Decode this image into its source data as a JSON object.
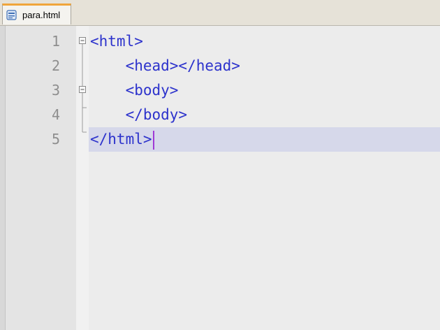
{
  "tab": {
    "filename": "para.html",
    "icon": "file-html-icon",
    "accent": "#f0a53b"
  },
  "editor": {
    "line_numbers": [
      "1",
      "2",
      "3",
      "4",
      "5"
    ],
    "lines": [
      "<html>",
      "    <head></head>",
      "    <body>",
      "    </body>",
      "</html>"
    ],
    "current_line": 5,
    "colors": {
      "tag": "#2d33cc",
      "line_number": "#8e8e8e",
      "current_line_bg": "#d6d8ea",
      "caret": "#a03ad6"
    }
  }
}
